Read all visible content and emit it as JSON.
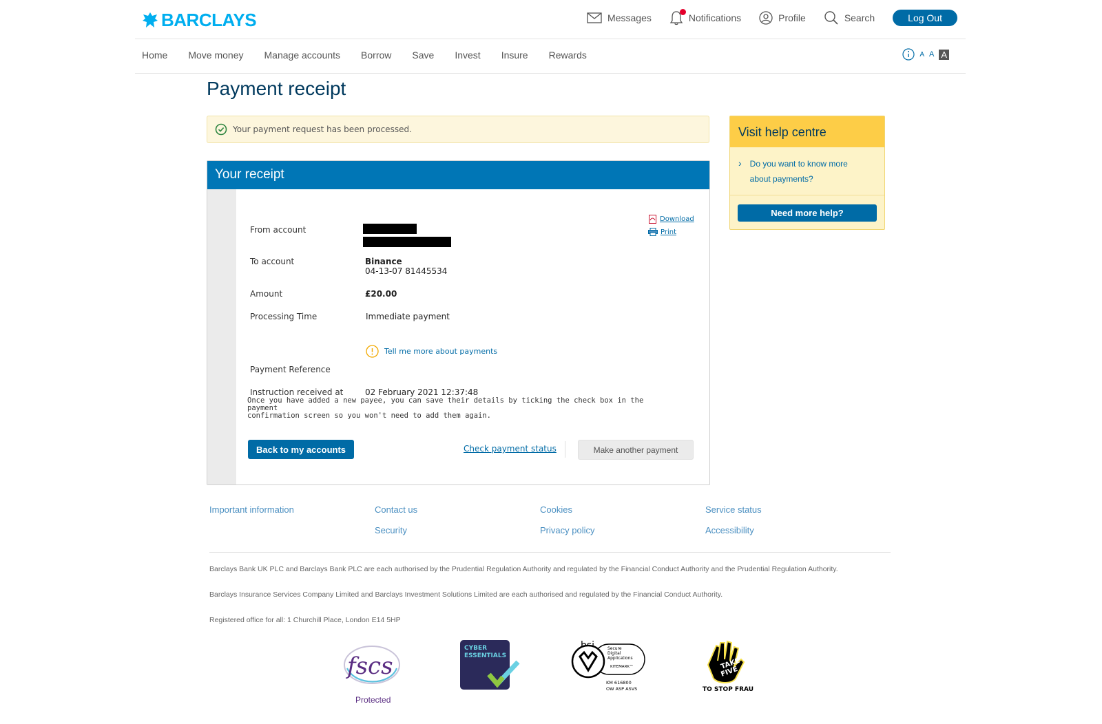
{
  "header": {
    "brand": "BARCLAYS",
    "util": {
      "messages": "Messages",
      "notifications": "Notifications",
      "profile": "Profile",
      "search": "Search",
      "logout": "Log Out"
    }
  },
  "nav": {
    "items": [
      "Home",
      "Move money",
      "Manage accounts",
      "Borrow",
      "Save",
      "Invest",
      "Insure",
      "Rewards"
    ],
    "text_size": [
      "A",
      "A",
      "A"
    ]
  },
  "page": {
    "title": "Payment receipt",
    "success_message": "Your payment request has been processed."
  },
  "receipt": {
    "title": "Your receipt",
    "download": "Download",
    "print": "Print",
    "from_label": "From account",
    "to_label": "To account",
    "to_name": "Binance",
    "to_number": "04-13-07 81445534",
    "amount_label": "Amount",
    "amount": "£20.00",
    "processing_label": "Processing Time",
    "processing_value": "Immediate payment",
    "tell_more": "Tell me more about payments",
    "reference_label": "Payment Reference",
    "instruction_label": "Instruction received at",
    "instruction_value": "02 February 2021 12:37:48",
    "note_line1": "Once you have added a new payee, you can save their details by ticking the check box in the payment",
    "note_line2": "confirmation screen so you won't need to add them again.",
    "back_button": "Back to my accounts",
    "check_status": "Check payment status",
    "another_payment": "Make another payment"
  },
  "help": {
    "title": "Visit help centre",
    "link_line1": "Do you want to know more",
    "link_line2": "about payments?",
    "button": "Need more help?"
  },
  "footer": {
    "links": {
      "important": "Important information",
      "contact": "Contact us",
      "cookies": "Cookies",
      "service": "Service status",
      "security": "Security",
      "privacy": "Privacy policy",
      "accessibility": "Accessibility"
    },
    "legal1": "Barclays Bank UK PLC and Barclays Bank PLC are each authorised by the Prudential Regulation Authority and regulated by the Financial Conduct Authority and the Prudential Regulation Authority.",
    "legal2": "Barclays Insurance Services Company Limited and Barclays Investment Solutions Limited are each authorised and regulated by the Financial Conduct Authority.",
    "legal3": "Registered office for all: 1 Churchill Place, London E14 5HP",
    "badges": {
      "fscs_text": "fscs",
      "fscs_label": "Protected",
      "cyber_line1": "CYBER",
      "cyber_line2": "ESSENTIALS",
      "bsi_text": "bsi",
      "bsi_line1": "Secure",
      "bsi_line2": "Digital",
      "bsi_line3": "Applications",
      "bsi_line4": "KITEMARK™",
      "bsi_code1": "KM 616800",
      "bsi_code2": "OW ASP ASVS",
      "takefive_line1": "TAKE",
      "takefive_line2": "FIVE",
      "takefive_label": "TO STOP FRAUD"
    }
  },
  "colors": {
    "brand_blue": "#00aeef",
    "primary": "#006ba6",
    "receipt_header": "#0076b6",
    "help_yellow": "#fdcd47",
    "success_green": "#2e8540"
  }
}
